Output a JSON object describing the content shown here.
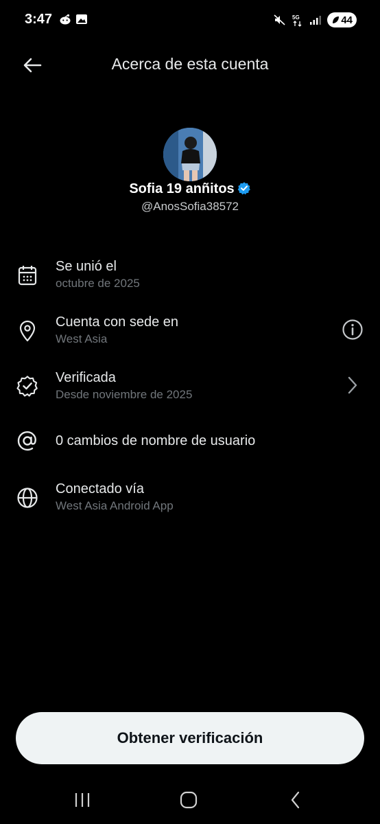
{
  "status_bar": {
    "time": "3:47",
    "battery": "44",
    "network": "5G"
  },
  "header": {
    "title": "Acerca de esta cuenta"
  },
  "profile": {
    "display_name": "Sofia 19 anñitos",
    "handle": "@AnosSofia38572"
  },
  "rows": [
    {
      "title": "Se unió el",
      "subtitle": "octubre de 2025",
      "icon": "calendar-icon"
    },
    {
      "title": "Cuenta con sede en",
      "subtitle": "West Asia",
      "icon": "location-pin-icon",
      "action_icon": "info-icon"
    },
    {
      "title": "Verificada",
      "subtitle": "Desde noviembre de 2025",
      "icon": "verified-badge-icon",
      "action_icon": "chevron-right-icon"
    },
    {
      "title": "0 cambios de nombre de usuario",
      "icon": "at-sign-icon"
    },
    {
      "title": "Conectado vía",
      "subtitle": "West Asia Android App",
      "icon": "globe-icon"
    }
  ],
  "cta": {
    "label": "Obtener verificación"
  },
  "colors": {
    "background": "#000000",
    "text_primary": "#e7e9ea",
    "text_secondary": "#71767b",
    "verified_blue": "#1d9bf0",
    "button_bg": "#eff3f4"
  }
}
